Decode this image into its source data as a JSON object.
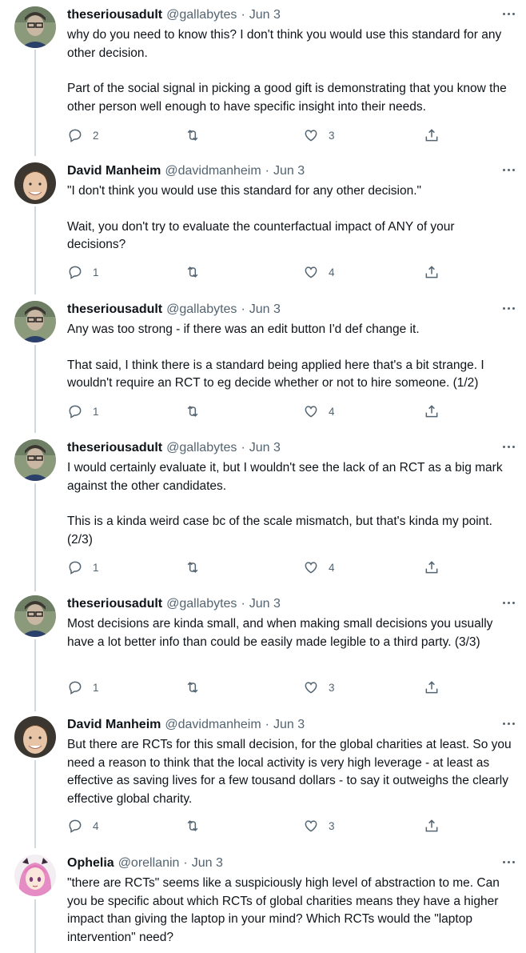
{
  "tweets": [
    {
      "name": "theseriousadult",
      "handle": "@gallabytes",
      "sep": "·",
      "date": "Jun 3",
      "paragraphs": [
        "why do you need to know this? I don't think you would use this standard for any other decision.",
        "Part of the social signal in picking a good gift is demonstrating that you know the other person well enough to have specific insight into their needs."
      ],
      "replies": "2",
      "retweets": "",
      "likes": "3"
    },
    {
      "name": "David Manheim",
      "handle": "@davidmanheim",
      "sep": "·",
      "date": "Jun 3",
      "paragraphs": [
        "\"I don't think you would use this standard for any other decision.\"",
        "Wait, you don't try to evaluate the counterfactual impact of ANY of your decisions?"
      ],
      "replies": "1",
      "retweets": "",
      "likes": "4"
    },
    {
      "name": "theseriousadult",
      "handle": "@gallabytes",
      "sep": "·",
      "date": "Jun 3",
      "paragraphs": [
        "Any was too strong - if there was an edit button I'd def change it.",
        "That said, I think there is a standard being applied here that's a bit strange. I wouldn't require an RCT to eg decide whether or not to hire someone. (1/2)"
      ],
      "replies": "1",
      "retweets": "",
      "likes": "4"
    },
    {
      "name": "theseriousadult",
      "handle": "@gallabytes",
      "sep": "·",
      "date": "Jun 3",
      "paragraphs": [
        "I would certainly evaluate it, but I wouldn't see the lack of an RCT as a big mark against the other candidates.",
        "This is a kinda weird case bc of the scale mismatch, but that's kinda my point. (2/3)"
      ],
      "replies": "1",
      "retweets": "",
      "likes": "4"
    },
    {
      "name": "theseriousadult",
      "handle": "@gallabytes",
      "sep": "·",
      "date": "Jun 3",
      "paragraphs": [
        "Most decisions are kinda small, and when making small decisions you usually have a lot better info than could be easily made legible to a third party. (3/3)"
      ],
      "replies": "1",
      "retweets": "",
      "likes": "3"
    },
    {
      "name": "David Manheim",
      "handle": "@davidmanheim",
      "sep": "·",
      "date": "Jun 3",
      "paragraphs": [
        "But there are RCTs for this small decision, for the global charities at least. So you need a reason to think that the local activity is very high leverage - at least as effective as saving lives for a few tousand dollars - to say it outweighs the clearly effective global charity."
      ],
      "replies": "4",
      "retweets": "",
      "likes": "3"
    },
    {
      "name": "Ophelia",
      "handle": "@orellanin",
      "sep": "·",
      "date": "Jun 3",
      "paragraphs": [
        "\"there are RCTs\" seems like a suspiciously high level of abstraction to me. Can you be specific about which RCTs of global charities means they have a higher impact than giving the laptop in your mind? Which RCTs would the \"laptop intervention\" need?"
      ]
    }
  ],
  "icons": {
    "reply": "reply-icon",
    "retweet": "retweet-icon",
    "like": "heart-icon",
    "share": "share-icon",
    "more": "more-icon"
  },
  "colors": {
    "text": "#0f1419",
    "secondary": "#536471",
    "thread_line": "#cfd9de"
  }
}
